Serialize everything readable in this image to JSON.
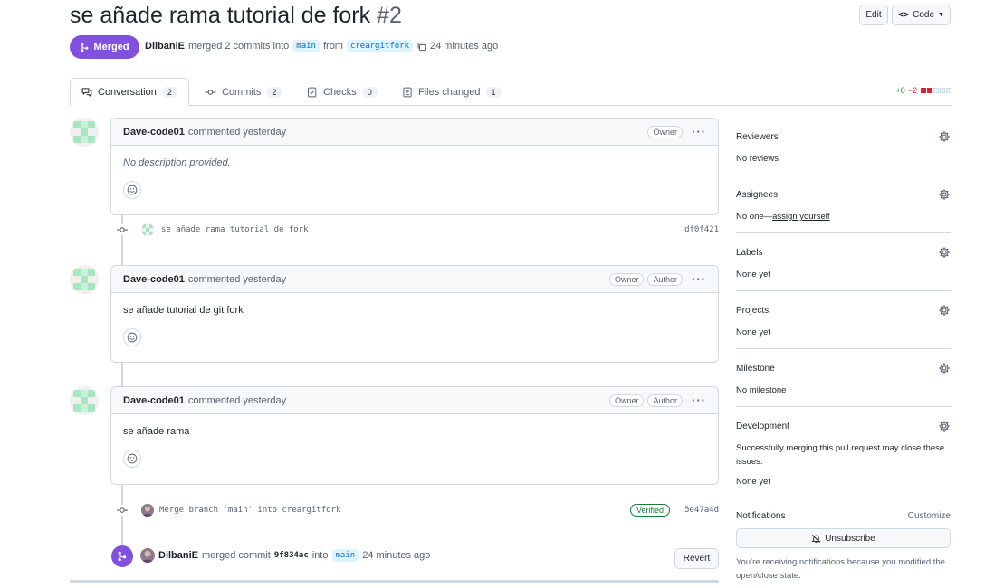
{
  "header": {
    "title": "se añade rama tutorial de fork",
    "number": "#2",
    "edit_label": "Edit",
    "code_label": "Code"
  },
  "status": {
    "badge": "Merged",
    "author": "DilbaniE",
    "merged_text": "merged 2 commits into",
    "base_branch": "main",
    "from_text": "from",
    "head_branch": "creargitfork",
    "time": "24 minutes ago"
  },
  "tabs": [
    {
      "label": "Conversation",
      "count": "2"
    },
    {
      "label": "Commits",
      "count": "2"
    },
    {
      "label": "Checks",
      "count": "0"
    },
    {
      "label": "Files changed",
      "count": "1"
    }
  ],
  "diffstat": {
    "additions": "+0",
    "deletions": "−2"
  },
  "comments": [
    {
      "author": "Dave-code01",
      "action": "commented yesterday",
      "badges": [
        "Owner"
      ],
      "body": "No description provided."
    },
    {
      "author": "Dave-code01",
      "action": "commented yesterday",
      "badges": [
        "Owner",
        "Author"
      ],
      "body": "se añade tutorial de git fork"
    },
    {
      "author": "Dave-code01",
      "action": "commented yesterday",
      "badges": [
        "Owner",
        "Author"
      ],
      "body": "se añade rama"
    }
  ],
  "commits": [
    {
      "message": "se añade rama tutorial de fork",
      "sha": "df0f421"
    },
    {
      "message": "Merge branch 'main' into creargitfork",
      "sha": "5e47a4d",
      "verified": "Verified"
    }
  ],
  "merge_event": {
    "author": "DilbaniE",
    "text": "merged commit",
    "sha": "9f834ac",
    "into": "into",
    "branch": "main",
    "time": "24 minutes ago",
    "revert_label": "Revert"
  },
  "sidebar": {
    "reviewers": {
      "title": "Reviewers",
      "value": "No reviews"
    },
    "assignees": {
      "title": "Assignees",
      "value": "No one—",
      "link": "assign yourself"
    },
    "labels": {
      "title": "Labels",
      "value": "None yet"
    },
    "projects": {
      "title": "Projects",
      "value": "None yet"
    },
    "milestone": {
      "title": "Milestone",
      "value": "No milestone"
    },
    "development": {
      "title": "Development",
      "desc": "Successfully merging this pull request may close these issues.",
      "value": "None yet"
    },
    "notifications": {
      "title": "Notifications",
      "customize": "Customize",
      "unsubscribe": "Unsubscribe",
      "note": "You’re receiving notifications because you modified the open/close state."
    }
  },
  "colors": {
    "merged": "#8250df",
    "verified": "#1a7f37",
    "border": "#d1d9e0",
    "additions": "#1a7f37",
    "deletions": "#d1242f"
  }
}
